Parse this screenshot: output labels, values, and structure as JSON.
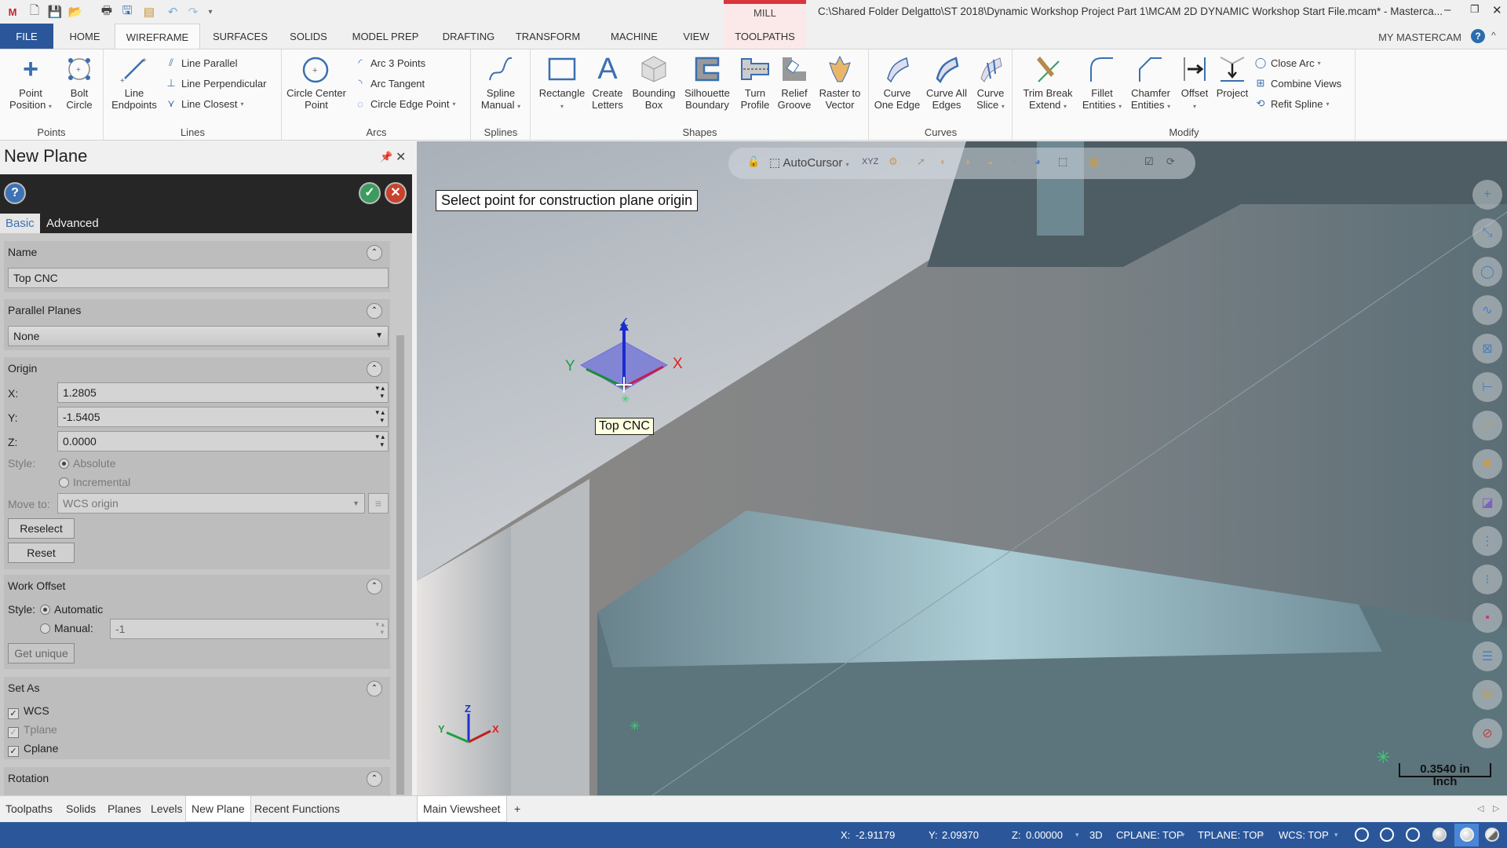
{
  "titlebar": {
    "context_tab": "MILL",
    "title": "C:\\Shared Folder Delgatto\\ST 2018\\Dynamic Workshop Project Part 1\\MCAM 2D DYNAMIC Workshop Start File.mcam* - Masterca...",
    "quick_access": [
      "app-logo",
      "new-file",
      "save",
      "open",
      "print",
      "save-as",
      "tree",
      "undo",
      "redo",
      "customize"
    ],
    "minimize": "‒",
    "restore": "❐",
    "close": "✕"
  },
  "tabs": [
    "FILE",
    "HOME",
    "WIREFRAME",
    "SURFACES",
    "SOLIDS",
    "MODEL PREP",
    "DRAFTING",
    "TRANSFORM",
    "MACHINE",
    "VIEW",
    "TOOLPATHS"
  ],
  "active_tab": "WIREFRAME",
  "my_mastercam": "MY MASTERCAM",
  "ribbon": {
    "points": {
      "label": "Points",
      "buttons": [
        {
          "label": "Point Position",
          "dropdown": true
        },
        {
          "label": "Bolt Circle"
        }
      ]
    },
    "lines": {
      "label": "Lines",
      "big": {
        "label": "Line Endpoints"
      },
      "small": [
        {
          "label": "Line Parallel"
        },
        {
          "label": "Line Perpendicular"
        },
        {
          "label": "Line Closest",
          "dropdown": true
        }
      ]
    },
    "arcs": {
      "label": "Arcs",
      "big": {
        "label": "Circle Center Point"
      },
      "small": [
        {
          "label": "Arc 3 Points"
        },
        {
          "label": "Arc Tangent"
        },
        {
          "label": "Circle Edge Point",
          "dropdown": true
        }
      ]
    },
    "splines": {
      "label": "Splines",
      "buttons": [
        {
          "label": "Spline Manual",
          "dropdown": true
        }
      ]
    },
    "shapes": {
      "label": "Shapes",
      "buttons": [
        {
          "label": "Rectangle",
          "dropdown": true
        },
        {
          "label": "Create Letters"
        },
        {
          "label": "Bounding Box"
        },
        {
          "label": "Silhouette Boundary"
        },
        {
          "label": "Turn Profile"
        },
        {
          "label": "Relief Groove"
        },
        {
          "label": "Raster to Vector"
        }
      ]
    },
    "curves": {
      "label": "Curves",
      "buttons": [
        {
          "label": "Curve One Edge"
        },
        {
          "label": "Curve All Edges"
        },
        {
          "label": "Curve Slice",
          "dropdown": true
        }
      ]
    },
    "modify": {
      "label": "Modify",
      "buttons": [
        {
          "label": "Trim Break Extend",
          "dropdown": true
        },
        {
          "label": "Fillet Entities",
          "dropdown": true
        },
        {
          "label": "Chamfer Entities",
          "dropdown": true
        },
        {
          "label": "Offset",
          "dropdown": true
        },
        {
          "label": "Project"
        }
      ],
      "small": [
        {
          "label": "Close Arc",
          "dropdown": true
        },
        {
          "label": "Combine Views"
        },
        {
          "label": "Refit Spline",
          "dropdown": true
        }
      ]
    }
  },
  "panel": {
    "title": "New Plane",
    "tabs": [
      "Basic",
      "Advanced"
    ],
    "active_tab": "Basic",
    "name_section": {
      "title": "Name",
      "value": "Top CNC"
    },
    "parallel_section": {
      "title": "Parallel Planes",
      "value": "None"
    },
    "origin_section": {
      "title": "Origin",
      "x_label": "X:",
      "x": "1.2805",
      "y_label": "Y:",
      "y": "-1.5405",
      "z_label": "Z:",
      "z": "0.0000",
      "style_label": "Style:",
      "style_options": [
        "Absolute",
        "Incremental"
      ],
      "style_selected": "Absolute",
      "move_to_label": "Move to:",
      "move_to": "WCS origin",
      "reselect": "Reselect",
      "reset": "Reset"
    },
    "work_offset_section": {
      "title": "Work Offset",
      "style_label": "Style:",
      "automatic": "Automatic",
      "manual": "Manual:",
      "selected": "Automatic",
      "manual_value": "-1",
      "get_unique": "Get unique"
    },
    "set_as_section": {
      "title": "Set As",
      "options": [
        {
          "label": "WCS",
          "checked": true
        },
        {
          "label": "Tplane",
          "checked": true,
          "disabled": true
        },
        {
          "label": "Cplane",
          "checked": true
        }
      ]
    },
    "rotation_section": {
      "title": "Rotation"
    }
  },
  "bottom_tabs": [
    "Toolpaths",
    "Solids",
    "Planes",
    "Levels",
    "New Plane",
    "Recent Functions"
  ],
  "bottom_active": "New Plane",
  "viewsheet_tabs": [
    "Main Viewsheet",
    "+"
  ],
  "viewport": {
    "prompt": "Select point for construction plane origin",
    "plane_label": "Top CNC",
    "gnomon": {
      "x": "X",
      "y": "Y",
      "z": "Z"
    },
    "autocursor_label": "AutoCursor",
    "scale_value": "0.3540 in",
    "scale_unit": "Inch",
    "right_toolbar": [
      "point-icon",
      "line-icon",
      "circle-icon",
      "spline-icon",
      "solid-icon",
      "dimension-icon",
      "wireframe-icon",
      "solids-icon",
      "planes-icon",
      "levels-icon",
      "attributes-icon",
      "colors-icon",
      "layers-icon",
      "settings-icon",
      "clear-icon"
    ]
  },
  "status": {
    "x_label": "X:",
    "x": "-2.91179",
    "y_label": "Y:",
    "y": "2.09370",
    "z_label": "Z:",
    "z": "0.00000",
    "mode": "3D",
    "cplane": "CPLANE: TOP",
    "tplane": "TPLANE: TOP",
    "wcs": "WCS: TOP"
  },
  "colors": {
    "accent": "#2b579a",
    "context": "#d9363e",
    "x_axis": "#e02020",
    "y_axis": "#20a040",
    "z_axis": "#2030d0"
  }
}
